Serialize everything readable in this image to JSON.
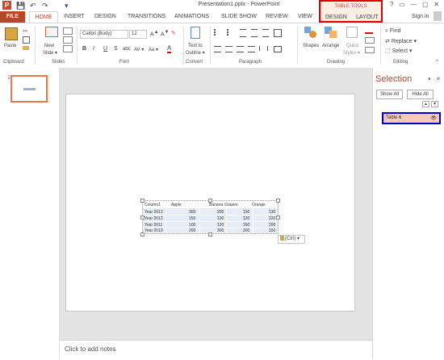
{
  "title_bar": {
    "document_title": "Presentation1.pptx - PowerPoint",
    "app_icon": "P",
    "window_controls": [
      "?",
      "▭",
      "—",
      "▢",
      "✕"
    ]
  },
  "quick_access": {
    "save_icon": "💾",
    "undo_icon": "↶",
    "redo_icon": "↷",
    "customize_icon": "▾"
  },
  "contextual_tab_group": {
    "title": "TABLE TOOLS",
    "tabs": [
      "DESIGN",
      "LAYOUT"
    ]
  },
  "tabs": [
    "FILE",
    "HOME",
    "INSERT",
    "DESIGN",
    "TRANSITIONS",
    "ANIMATIONS",
    "SLIDE SHOW",
    "REVIEW",
    "VIEW"
  ],
  "signin": "Sign in",
  "ribbon": {
    "clipboard": {
      "label": "Clipboard",
      "paste": "Paste"
    },
    "slides": {
      "label": "Slides",
      "new_slide": "New",
      "new_slide_2": "Slide ▾"
    },
    "font": {
      "label": "Font",
      "font_name": "Calibri (Body)",
      "font_size": "12",
      "bold": "B",
      "italic": "I",
      "underline": "U",
      "strike": "S",
      "shadow": "abc",
      "spacing": "AV ▾",
      "case": "Aa ▾",
      "color": "A"
    },
    "convert": {
      "label": "Convert",
      "text_to": "Text to",
      "smartart": "Outline ▾"
    },
    "paragraph": {
      "label": "Paragraph"
    },
    "drawing": {
      "label": "Drawing",
      "shapes": "Shapes",
      "arrange": "Arrange",
      "quick_styles": "Quick",
      "quick_styles_2": "Styles ▾"
    },
    "editing": {
      "label": "Editing",
      "find": "Find",
      "replace": "Replace ▾",
      "select": "Select ▾"
    }
  },
  "slide_panel": {
    "slide_number": "1"
  },
  "table": {
    "headers": [
      "Column1",
      "Apple",
      "Banana",
      "Grapes",
      "Orange"
    ],
    "rows": [
      [
        "Year 2013",
        "300",
        "200",
        "150",
        "130"
      ],
      [
        "Year 2012",
        "150",
        "130",
        "120",
        "220"
      ],
      [
        "Year 2011",
        "100",
        "120",
        "160",
        "200"
      ],
      [
        "Year 2010",
        "200",
        "300",
        "200",
        "150"
      ]
    ]
  },
  "paste_options": "(Ctrl) ▾",
  "notes": "Click to add notes",
  "selection_pane": {
    "title": "Selection",
    "show_all": "Show All",
    "hide_all": "Hide All",
    "item": "Table 6",
    "eye_icon": "👁",
    "up": "▲",
    "down": "▼",
    "collapse": "▾",
    "close": "✕"
  }
}
